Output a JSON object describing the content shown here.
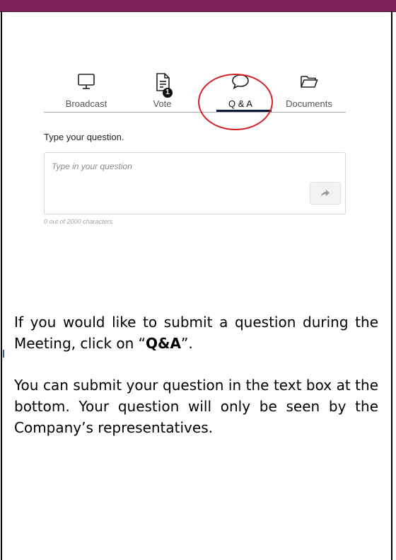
{
  "tabs": {
    "broadcast_label": "Broadcast",
    "vote_label": "Vote",
    "vote_badge": "1",
    "qa_label": "Q & A",
    "documents_label": "Documents",
    "active": "Q & A"
  },
  "question": {
    "prompt": "Type your question.",
    "placeholder": "Type in your question",
    "char_count": "0 out of 2000  characters."
  },
  "icons": {
    "broadcast": "monitor-icon",
    "vote": "document-icon",
    "qa": "speech-bubble-icon",
    "documents": "folder-icon",
    "send": "share-arrow-icon"
  },
  "instructions": {
    "p1_pre": "If you would like to submit a question during the Meeting, click on “",
    "p1_bold": "Q&A",
    "p1_post": "”.",
    "p2": "You can submit your question in the text box at the bottom. Your question will only be seen by the Company’s representatives."
  },
  "colors": {
    "header_bar": "#7a1f5a",
    "active_tab_underline": "#0d1b3e",
    "highlight_circle": "#d61f26"
  }
}
